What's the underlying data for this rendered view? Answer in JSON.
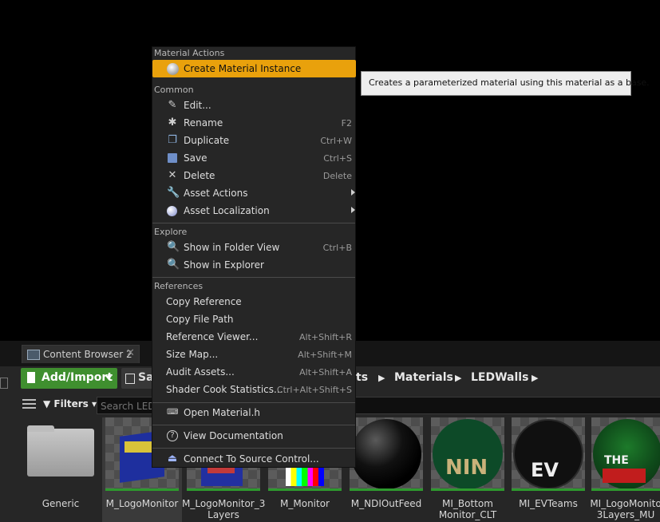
{
  "content_browser": {
    "tab_title": "Content Browser 2",
    "add_import_label": "Add/Import",
    "save_label": "Sa",
    "breadcrumb": [
      "ts",
      "Materials",
      "LEDWalls"
    ],
    "filters_label": "Filters",
    "search_placeholder": "Search LED",
    "assets": [
      {
        "name_line1": "Generic",
        "name_line2": "",
        "kind": "folder"
      },
      {
        "name_line1": "M_LogoMonitor",
        "name_line2": "",
        "kind": "selected"
      },
      {
        "name_line1": "M_LogoMonitor_3",
        "name_line2": "Layers",
        "kind": "material"
      },
      {
        "name_line1": "M_Monitor",
        "name_line2": "",
        "kind": "material"
      },
      {
        "name_line1": "M_NDIOutFeed",
        "name_line2": "",
        "kind": "material"
      },
      {
        "name_line1": "MI_Bottom",
        "name_line2": "Monitor_CLT",
        "kind": "instance"
      },
      {
        "name_line1": "MI_EVTeams",
        "name_line2": "",
        "kind": "instance"
      },
      {
        "name_line1": "MI_LogoMonito",
        "name_line2": "3Layers_MU",
        "kind": "instance"
      }
    ],
    "thumb_text": {
      "nin": "NIN",
      "ev": "EV",
      "the": "THE"
    }
  },
  "context_menu": {
    "sections": {
      "material_actions": "Material Actions",
      "common": "Common",
      "explore": "Explore",
      "references": "References"
    },
    "create_material_instance": {
      "label": "Create Material Instance",
      "icon": "material-instance-icon"
    },
    "common": [
      {
        "label": "Edit...",
        "shortcut": "",
        "icon": "edit-icon"
      },
      {
        "label": "Rename",
        "shortcut": "F2",
        "icon": "rename-icon"
      },
      {
        "label": "Duplicate",
        "shortcut": "Ctrl+W",
        "icon": "duplicate-icon"
      },
      {
        "label": "Save",
        "shortcut": "Ctrl+S",
        "icon": "save-icon"
      },
      {
        "label": "Delete",
        "shortcut": "Delete",
        "icon": "delete-icon"
      },
      {
        "label": "Asset Actions",
        "shortcut": "",
        "icon": "wrench-icon"
      },
      {
        "label": "Asset Localization",
        "shortcut": "",
        "icon": "globe-icon"
      }
    ],
    "explore": [
      {
        "label": "Show in Folder View",
        "shortcut": "Ctrl+B",
        "icon": "magnifier-icon"
      },
      {
        "label": "Show in Explorer",
        "shortcut": "",
        "icon": "magnifier-icon"
      }
    ],
    "references": [
      {
        "label": "Copy Reference",
        "shortcut": ""
      },
      {
        "label": "Copy File Path",
        "shortcut": ""
      },
      {
        "label": "Reference Viewer...",
        "shortcut": "Alt+Shift+R"
      },
      {
        "label": "Size Map...",
        "shortcut": "Alt+Shift+M"
      },
      {
        "label": "Audit Assets...",
        "shortcut": "Alt+Shift+A"
      },
      {
        "label": "Shader Cook Statistics...",
        "shortcut": "Ctrl+Alt+Shift+S"
      }
    ],
    "open_source": "Open Material.h",
    "view_documentation": "View Documentation",
    "connect_source_control": "Connect To Source Control..."
  },
  "tooltip": "Creates a parameterized material using this material as a base.",
  "colors": {
    "highlight": "#e9a10c",
    "add_button": "#3f8f2f"
  }
}
